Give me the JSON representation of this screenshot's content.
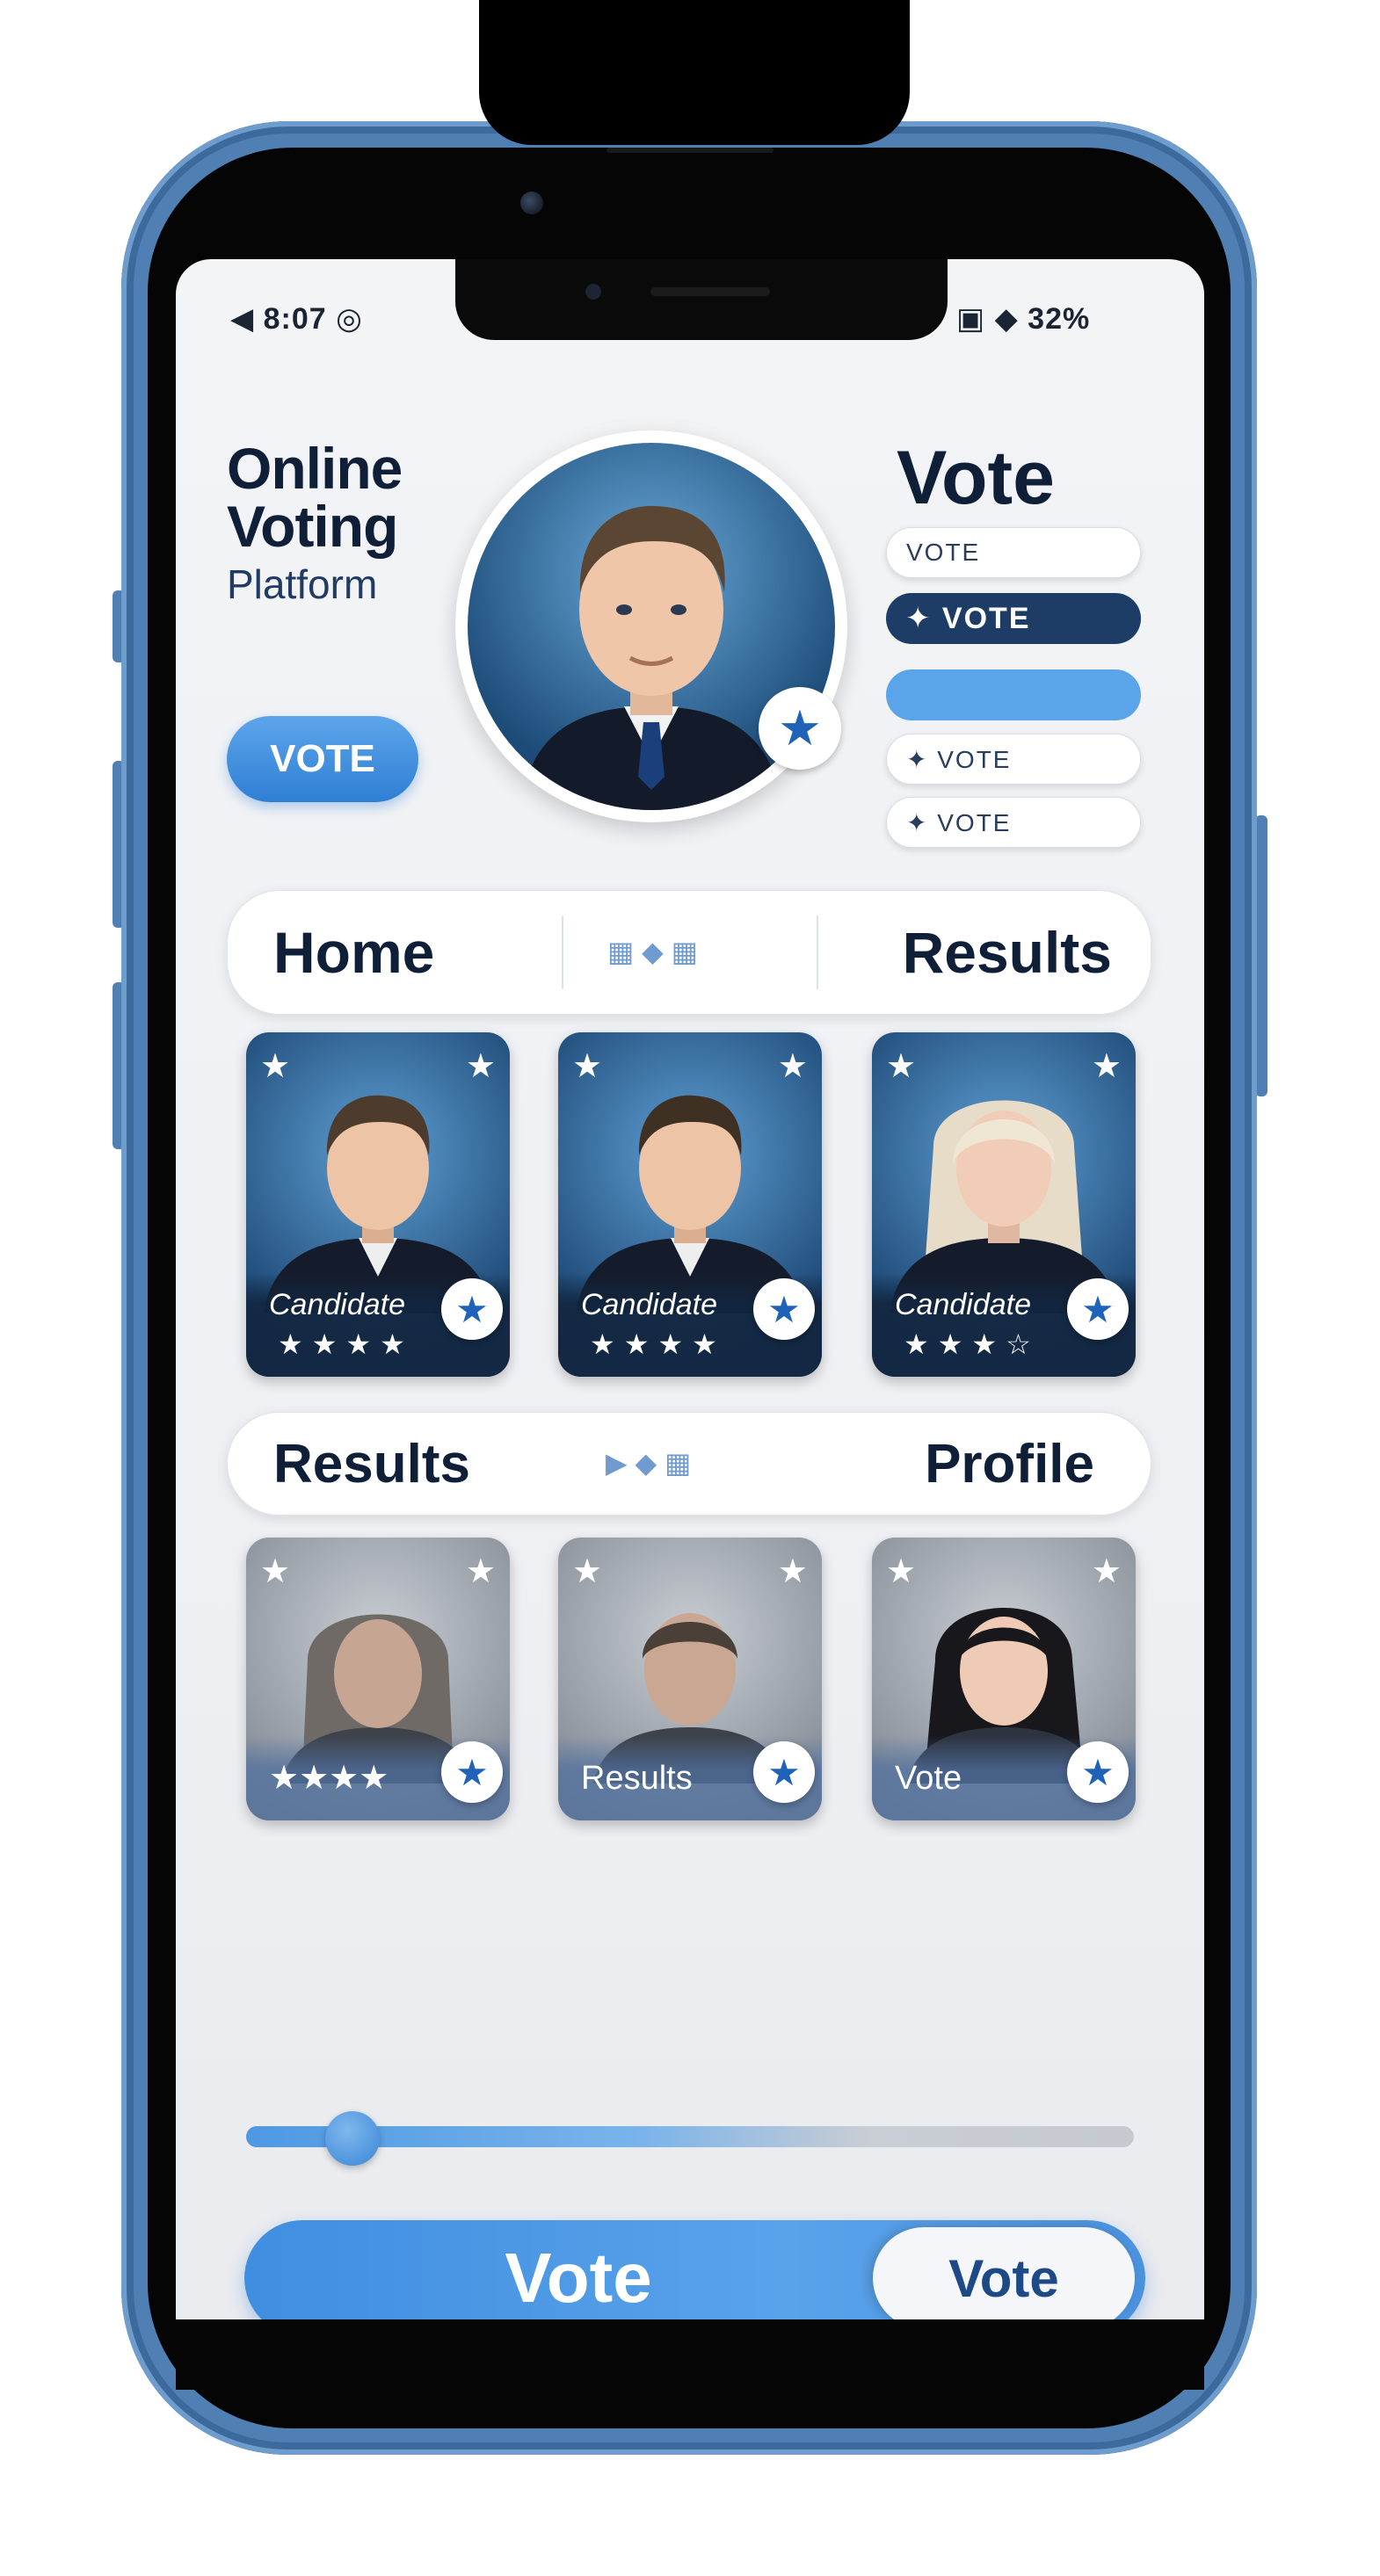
{
  "status_bar": {
    "left": "◀ 8:07 ◎",
    "right": "▣ ◆ 32%"
  },
  "header": {
    "title_line1": "Online",
    "title_line2": "Voting",
    "title_line3": "Platform",
    "vote_pill": "VOTE",
    "vote_heading": "Vote"
  },
  "side_options": [
    {
      "label": "VOTE",
      "style": "light"
    },
    {
      "label": "✦ VOTE",
      "style": "dark"
    },
    {
      "label": "",
      "style": "blue"
    },
    {
      "label": "✦ VOTE",
      "style": "light"
    },
    {
      "label": "✦ VOTE",
      "style": "light"
    }
  ],
  "nav1": {
    "left": "Home",
    "right": "Results",
    "mid": "▦  ◆  ▦"
  },
  "candidates_row1": [
    {
      "name": "Candidate",
      "stars": "★★★★"
    },
    {
      "name": "Candidate",
      "stars": "★★★★"
    },
    {
      "name": "Candidate",
      "stars": "★★★☆"
    }
  ],
  "nav2": {
    "left": "Results",
    "right": "Profile",
    "mid": "▶  ◆  ▦"
  },
  "candidates_row2": [
    {
      "name": "★★★★"
    },
    {
      "name": "Results"
    },
    {
      "name": "Vote"
    }
  ],
  "slider": {
    "value_percent": 12
  },
  "vote_button": {
    "label": "Vote",
    "knob_label": "Vote"
  },
  "icons": {
    "star": "star-icon",
    "avatar": "person-icon"
  },
  "colors": {
    "accent": "#3f8ee0",
    "navy": "#0f1f38",
    "frame": "#4f7fb3"
  }
}
